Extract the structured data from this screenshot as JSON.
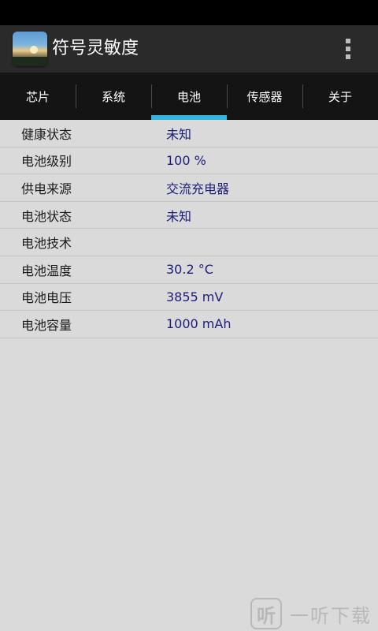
{
  "app": {
    "title": "符号灵敏度",
    "icon": "app-landscape-icon"
  },
  "header": {
    "overflow_icon": "overflow-menu-icon"
  },
  "tabs": [
    {
      "label": "芯片",
      "active": false
    },
    {
      "label": "系统",
      "active": false
    },
    {
      "label": "电池",
      "active": true
    },
    {
      "label": "传感器",
      "active": false
    },
    {
      "label": "关于",
      "active": false
    }
  ],
  "battery_rows": [
    {
      "label": "健康状态",
      "value": "未知"
    },
    {
      "label": "电池级别",
      "value": "100 %"
    },
    {
      "label": "供电来源",
      "value": "交流充电器"
    },
    {
      "label": "电池状态",
      "value": "未知"
    },
    {
      "label": "电池技术",
      "value": ""
    },
    {
      "label": "电池温度",
      "value": "30.2 °C"
    },
    {
      "label": "电池电压",
      "value": "3855 mV"
    },
    {
      "label": "电池容量",
      "value": "1000 mAh"
    }
  ],
  "watermark": {
    "icon_text": "听",
    "text": "一听下载"
  },
  "colors": {
    "accent": "#33b5e5",
    "value_text": "#1c1c7a",
    "background": "#dadada",
    "app_bar": "#2a2a2a",
    "tab_bar": "#141414"
  }
}
